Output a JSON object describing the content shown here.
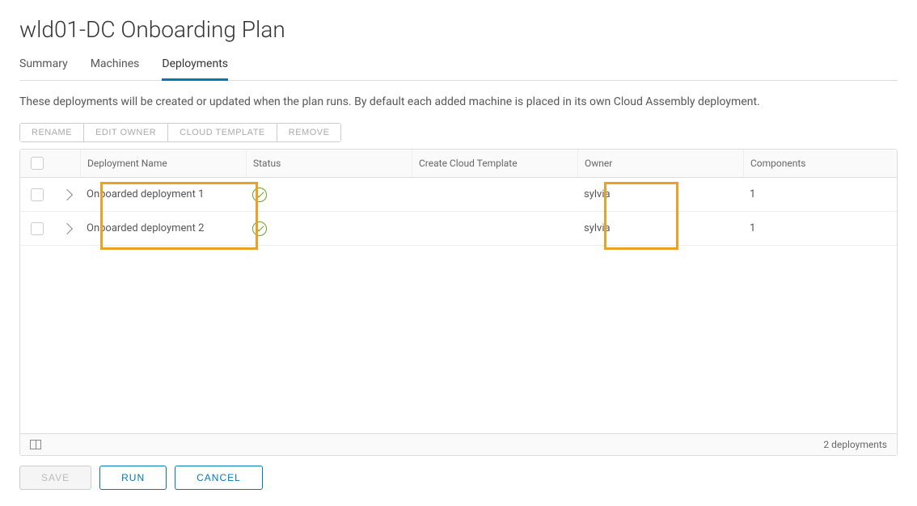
{
  "page_title": "wld01-DC Onboarding Plan",
  "tabs": [
    {
      "label": "Summary",
      "active": false
    },
    {
      "label": "Machines",
      "active": false
    },
    {
      "label": "Deployments",
      "active": true
    }
  ],
  "description": "These deployments will be created or updated when the plan runs. By default each added machine is placed in its own Cloud Assembly deployment.",
  "toolbar": {
    "rename": "RENAME",
    "edit_owner": "EDIT OWNER",
    "cloud_template": "CLOUD TEMPLATE",
    "remove": "REMOVE"
  },
  "table": {
    "headers": {
      "name": "Deployment Name",
      "status": "Status",
      "template": "Create Cloud Template",
      "owner": "Owner",
      "components": "Components"
    },
    "rows": [
      {
        "name": "Onboarded deployment 1",
        "status": "ok",
        "template": "",
        "owner": "sylvia",
        "components": "1"
      },
      {
        "name": "Onboarded deployment 2",
        "status": "ok",
        "template": "",
        "owner": "sylvia",
        "components": "1"
      }
    ],
    "footer_count": "2 deployments"
  },
  "actions": {
    "save": "SAVE",
    "run": "RUN",
    "cancel": "CANCEL"
  }
}
